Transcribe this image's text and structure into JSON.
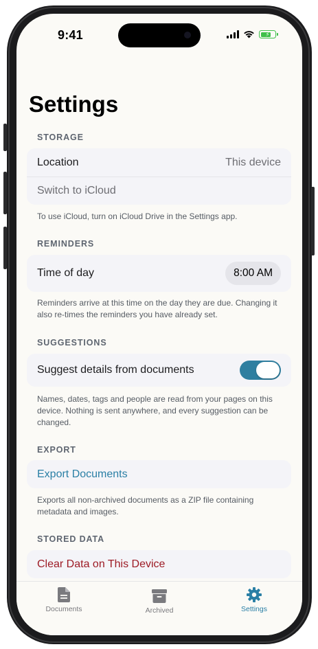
{
  "status": {
    "time": "9:41"
  },
  "page": {
    "title": "Settings"
  },
  "storage": {
    "header": "STORAGE",
    "location_label": "Location",
    "location_value": "This device",
    "switch_label": "Switch to iCloud",
    "footer": "To use iCloud, turn on iCloud Drive in the Settings app."
  },
  "reminders": {
    "header": "REMINDERS",
    "time_label": "Time of day",
    "time_value": "8:00 AM",
    "footer": "Reminders arrive at this time on the day they are due. Changing it also re-times the reminders you have already set."
  },
  "suggestions": {
    "header": "SUGGESTIONS",
    "toggle_label": "Suggest details from documents",
    "toggle_on": true,
    "footer": "Names, dates, tags and people are read from your pages on this device. Nothing is sent anywhere, and every suggestion can be changed."
  },
  "export": {
    "header": "EXPORT",
    "action_label": "Export Documents",
    "footer": "Exports all non-archived documents as a ZIP file containing metadata and images."
  },
  "stored_data": {
    "header": "STORED DATA",
    "action_label": "Clear Data on This Device"
  },
  "tabbar": {
    "tabs": [
      {
        "label": "Documents",
        "icon": "document-icon",
        "active": false
      },
      {
        "label": "Archived",
        "icon": "archive-box-icon",
        "active": false
      },
      {
        "label": "Settings",
        "icon": "gear-icon",
        "active": true
      }
    ]
  },
  "colors": {
    "accent": "#2a7fa5",
    "destructive": "#9d1b25",
    "toggle_on": "#2f7fa0",
    "background": "#fbfaf6",
    "card": "#f4f4f8"
  }
}
